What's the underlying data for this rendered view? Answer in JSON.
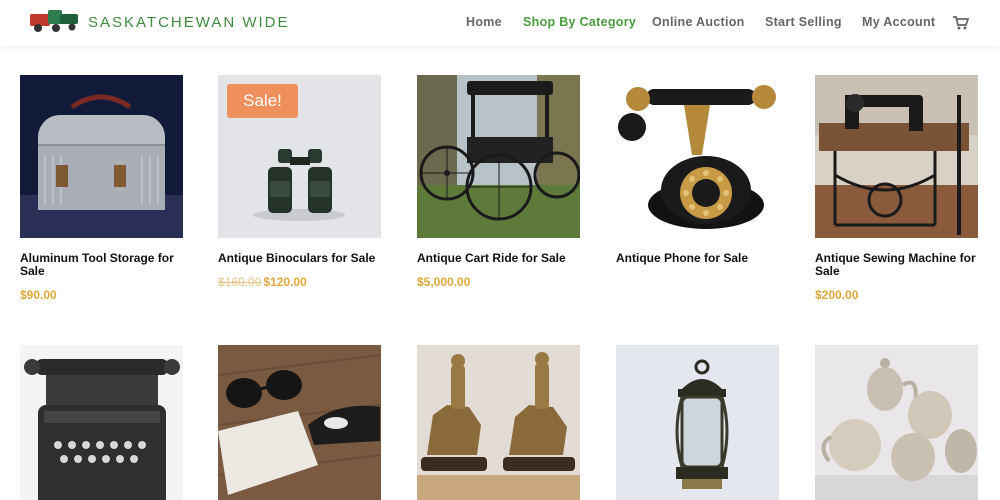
{
  "header": {
    "brand": "SASKATCHEWAN WIDE",
    "nav": [
      {
        "label": "Home"
      },
      {
        "label": "Shop By Category"
      },
      {
        "label": "Online Auction"
      },
      {
        "label": "Start Selling"
      },
      {
        "label": "My Account"
      }
    ],
    "icons": {
      "logo": "toy-truck-logo",
      "cart": "cart-icon"
    }
  },
  "colors": {
    "accent": "#4a9a3e",
    "price": "#e0a63a",
    "sale_badge": "#ef8f5b"
  },
  "products": [
    {
      "title": "Aluminum Tool Storage for Sale",
      "price": "$90.00",
      "old_price": ""
    },
    {
      "title": "Antique Binoculars for Sale",
      "price": "$120.00",
      "old_price": "$160.00",
      "badge": "Sale!"
    },
    {
      "title": "Antique Cart Ride for Sale",
      "price": "$5,000.00",
      "old_price": ""
    },
    {
      "title": "Antique Phone for Sale",
      "price": "",
      "old_price": ""
    },
    {
      "title": "Antique Sewing Machine for Sale",
      "price": "$200.00",
      "old_price": ""
    },
    {
      "title": "",
      "price": "",
      "old_price": ""
    },
    {
      "title": "",
      "price": "",
      "old_price": ""
    },
    {
      "title": "",
      "price": "",
      "old_price": ""
    },
    {
      "title": "",
      "price": "",
      "old_price": ""
    },
    {
      "title": "",
      "price": "",
      "old_price": ""
    }
  ]
}
